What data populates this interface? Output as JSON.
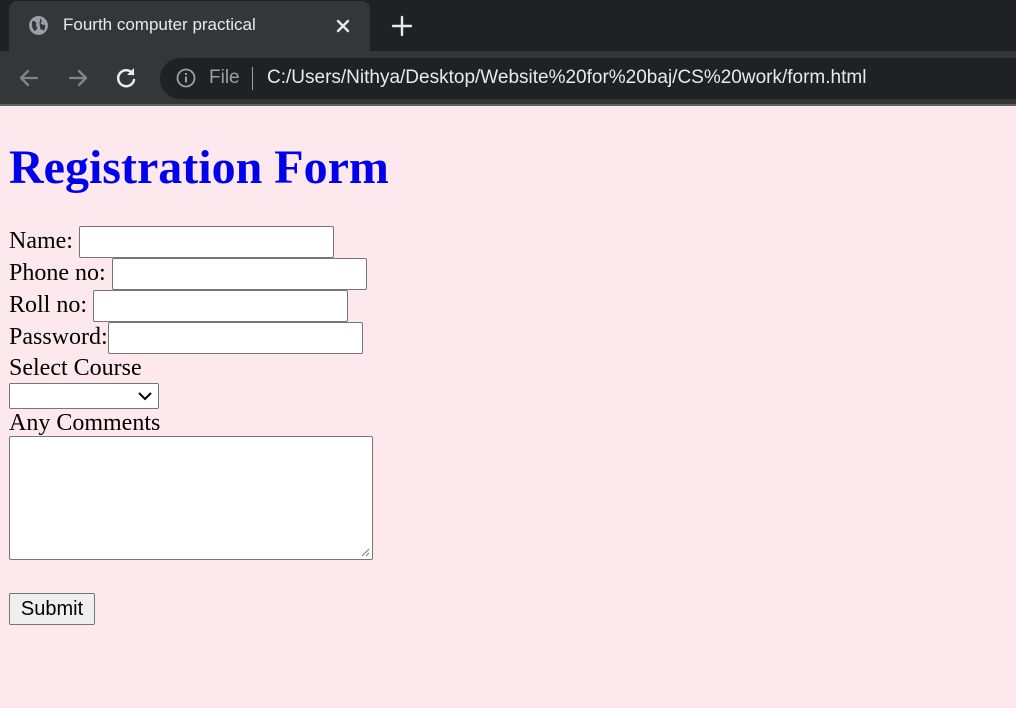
{
  "browser": {
    "tab_title": "Fourth computer practical",
    "file_label": "File",
    "url": "C:/Users/Nithya/Desktop/Website%20for%20baj/CS%20work/form.html",
    "icons": {
      "tab": "globe-icon",
      "close": "close-icon",
      "new_tab": "plus-icon",
      "back": "back-arrow-icon",
      "forward": "forward-arrow-icon",
      "reload": "reload-icon",
      "info": "info-icon"
    },
    "colors": {
      "frame": "#202124",
      "toolbar": "#35363a",
      "text": "#e8eaed"
    }
  },
  "form": {
    "heading": "Registration Form",
    "heading_color": "#0000ee",
    "background_color": "#fde8ee",
    "name_label": "Name:",
    "phone_label": "Phone no:",
    "roll_label": "Roll no:",
    "password_label": "Password:",
    "course_label": "Select Course",
    "comments_label": "Any Comments",
    "submit_label": "Submit",
    "name_value": "",
    "phone_value": "",
    "roll_value": "",
    "password_value": "",
    "course_selected": "",
    "comments_value": ""
  }
}
